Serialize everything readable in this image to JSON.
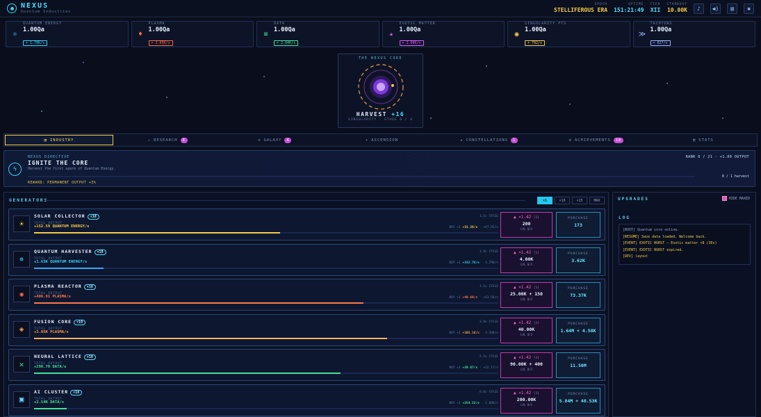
{
  "app": {
    "title": "NEXUS",
    "subtitle": "Quantum Industries"
  },
  "top_stats": [
    {
      "label": "EPOCH",
      "value": "STELLIFEROUS ERA"
    },
    {
      "label": "UPTIME",
      "value": "151:21:49"
    },
    {
      "label": "TIER",
      "value": "XII"
    },
    {
      "label": "STARDUST",
      "value": "10.00K"
    }
  ],
  "top_icons": [
    "music-icon",
    "volume-icon",
    "book-icon",
    "gear-icon"
  ],
  "resources": [
    {
      "name": "QUANTUM ENERGY",
      "value": "1.00Qa",
      "rate": "+ 1.78K/s",
      "color": "#36d3f5",
      "icon": "atom-icon",
      "glyph": "⚛"
    },
    {
      "name": "PLASMA",
      "value": "1.00Qa",
      "rate": "+ 3.05K/s",
      "color": "#ff6a4a",
      "icon": "flame-icon",
      "glyph": "♦"
    },
    {
      "name": "DATA",
      "value": "1.00Qa",
      "rate": "+ 2.84K/s",
      "color": "#44e39a",
      "icon": "data-icon",
      "glyph": "≡"
    },
    {
      "name": "EXOTIC MATTER",
      "value": "1.00Qa",
      "rate": "+ 1.08K/s",
      "color": "#e056ff",
      "icon": "star-icon",
      "glyph": "★"
    },
    {
      "name": "SINGULARITY PTS",
      "value": "1.00Qa",
      "rate": "+ 792/s",
      "color": "#f4cc4a",
      "icon": "singularity-icon",
      "glyph": "◉"
    },
    {
      "name": "TACHYONS",
      "value": "1.00Qa",
      "rate": "+ 827/s",
      "color": "#9fb6ff",
      "icon": "tachyon-icon",
      "glyph": "≫"
    }
  ],
  "core": {
    "title": "THE NEXUS CORE",
    "harvest": "HARVEST",
    "harvest_gain": "+16",
    "singularity": "SINGULARITY · STAGE 0 / 4"
  },
  "tabs": [
    {
      "label": "INDUSTRY",
      "icon": "factory-icon",
      "glyph": "▥",
      "active": true
    },
    {
      "label": "RESEARCH",
      "icon": "flask-icon",
      "glyph": "⚠",
      "badge": "4"
    },
    {
      "label": "GALAXY",
      "icon": "galaxy-icon",
      "glyph": "✲",
      "badge": "4"
    },
    {
      "label": "ASCENSION",
      "icon": "ascension-icon",
      "glyph": "✦"
    },
    {
      "label": "CONSTELLATIONS",
      "icon": "constellation-icon",
      "glyph": "★",
      "badge": "1"
    },
    {
      "label": "ACHIEVEMENTS",
      "icon": "trophy-icon",
      "glyph": "♛",
      "badge": "10"
    },
    {
      "label": "STATS",
      "icon": "stats-icon",
      "glyph": "▤"
    }
  ],
  "directive": {
    "label": "NEXUS DIRECTIVE",
    "title": "IGNITE THE CORE",
    "desc": "Harvest the first spark of Quantum Energy.",
    "reward": "REWARD: PERMANENT OUTPUT +3%",
    "rank": "RANK 0 / 21 · +1.00 OUTPUT",
    "progress": "0 / 1 harvest"
  },
  "generators_header": "GENERATORS",
  "multipliers": [
    {
      "label": "×1",
      "on": true
    },
    {
      "label": "×10"
    },
    {
      "label": "×25"
    },
    {
      "label": "MAX"
    }
  ],
  "generators": [
    {
      "name": "SOLAR COLLECTOR",
      "count": "×10",
      "total_label": "TOTAL OUTPUT",
      "output": "+152.59 QUANTUM ENERGY/s",
      "color": "#f4cc4a",
      "bar": "#f4cc4a",
      "progress": 0.53,
      "cycle": "1.1s CYCLE",
      "rate_left": "BUY +1",
      "rate_main": "+15.26/s",
      "rate_right": "· +47.95/s",
      "mult": "▲ ×1.42",
      "mult_sub": "[1]",
      "cost": "200",
      "lvl": "LVL 0/3",
      "purchase": "PURCHASE",
      "price": "173",
      "icon": "sun-icon",
      "glyph": "☀",
      "icolor": "#f4cc4a"
    },
    {
      "name": "QUANTUM HARVESTER",
      "count": "×10",
      "total_label": "TOTAL OUTPUT",
      "output": "+1.63K QUANTUM ENERGY/s",
      "color": "#36d3f5",
      "bar": "#36a8f5",
      "progress": 0.15,
      "cycle": "1.8s CYCLE",
      "rate_left": "BUY +1",
      "rate_main": "+162.78/s",
      "rate_right": "· 1.79K/s",
      "mult": "▲ ×1.42",
      "mult_sub": "[1]",
      "cost": "4.00K",
      "lvl": "LVL 0/3",
      "purchase": "PURCHASE",
      "price": "3.62K",
      "icon": "harvester-icon",
      "glyph": "✵",
      "icolor": "#36d3f5"
    },
    {
      "name": "PLASMA REACTOR",
      "count": "×10",
      "total_label": "TOTAL OUTPUT",
      "output": "+406.91 PLASMA/s",
      "color": "#ff7a4a",
      "bar": "#ff7a4a",
      "progress": 0.71,
      "cycle": "1.1s CYCLE",
      "rate_left": "BUY +1",
      "rate_main": "+40.69/s",
      "rate_right": "· +43.56/s",
      "mult": "▲ ×1.42",
      "mult_sub": "[1]",
      "cost": "25.00K + 150",
      "lvl": "LVL 0/3",
      "purchase": "PURCHASE",
      "price": "73.37K",
      "icon": "reactor-icon",
      "glyph": "✺",
      "icolor": "#ff6a4a"
    },
    {
      "name": "FUSION CORE",
      "count": "×10",
      "total_label": "TOTAL OUTPUT",
      "output": "+3.05K PLASMA/s",
      "color": "#ff9a4a",
      "bar": "#ffb45a",
      "progress": 0.76,
      "cycle": "3.0s CYCLE",
      "rate_left": "BUY +1",
      "rate_main": "+305.18/s",
      "rate_right": "· 3.34K/s",
      "mult": "▲ ×1.42",
      "mult_sub": "[1]",
      "cost": "40.00K",
      "lvl": "LVL 0/3",
      "purchase": "PURCHASE",
      "price": "1.64M + 4.58K",
      "icon": "fusion-icon",
      "glyph": "◈",
      "icolor": "#f4a04a"
    },
    {
      "name": "NEURAL LATTICE",
      "count": "×10",
      "total_label": "TOTAL OUTPUT",
      "output": "+296.70 DATA/s",
      "color": "#44e39a",
      "bar": "#44e39a",
      "progress": 0.66,
      "cycle": "2.5s CYCLE",
      "rate_left": "BUY +1",
      "rate_main": "+29.67/s",
      "rate_right": "· +32.17/s",
      "mult": "▲ ×1.42",
      "mult_sub": "[1]",
      "cost": "90.00K + 400",
      "lvl": "LVL 0/3",
      "purchase": "PURCHASE",
      "price": "11.50M",
      "icon": "network-icon",
      "glyph": "✕",
      "icolor": "#44e39a"
    },
    {
      "name": "AI CLUSTER",
      "count": "×10",
      "total_label": "TOTAL OUTPUT",
      "output": "+2.54K DATA/s",
      "color": "#44e39a",
      "bar": "#44e39a",
      "progress": 0.07,
      "cycle": "6.0s CYCLE",
      "rate_left": "BUY +1",
      "rate_main": "+254.32/s",
      "rate_right": "· 1.66K/s",
      "mult": "▲ ×1.42",
      "mult_sub": "[1]",
      "cost": "200.00K",
      "lvl": "LVL 0/3",
      "purchase": "PURCHASE",
      "price": "5.84M + 48.53K",
      "icon": "chip-icon",
      "glyph": "▣",
      "icolor": "#6fd3ff"
    }
  ],
  "upgrades": {
    "header": "UPGRADES",
    "hide_maxed": "HIDE MAXED"
  },
  "log": {
    "header": "LOG",
    "lines": [
      {
        "text": "[BOOT] Quantum core online.",
        "color": "#8fa6cc"
      },
      {
        "text": "[RESUME] Save data loaded. Welcome back.",
        "color": "#f4cc4a"
      },
      {
        "text": "[EVENT] EXOTIC BURST — Exotic matter ×8 (30s)",
        "color": "#f4cc4a"
      },
      {
        "text": "[EVENT] EXOTIC BURST expired.",
        "color": "#f4cc4a"
      },
      {
        "text": "[DEV] layout",
        "color": "#f4cc4a"
      }
    ]
  }
}
